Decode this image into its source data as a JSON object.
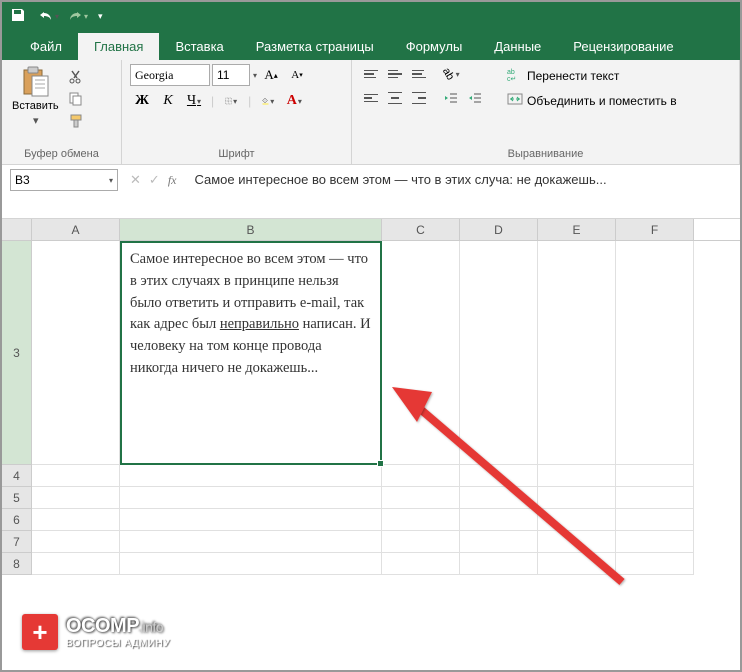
{
  "tabs": {
    "file": "Файл",
    "home": "Главная",
    "insert": "Вставка",
    "layout": "Разметка страницы",
    "formulas": "Формулы",
    "data": "Данные",
    "review": "Рецензирование"
  },
  "ribbon": {
    "clipboard": {
      "label": "Буфер обмена",
      "paste": "Вставить"
    },
    "font": {
      "label": "Шрифт",
      "name": "Georgia",
      "size": "11",
      "bold": "Ж",
      "italic": "К",
      "underline": "Ч"
    },
    "alignment": {
      "label": "Выравнивание",
      "wrap": "Перенести текст",
      "merge": "Объединить и поместить в"
    }
  },
  "namebox": "B3",
  "formula_bar": "Самое интересное во всем этом — что в этих случаях в принципе нельзя было ответить и отправить e-mail, так как адрес был неправильно написан. И человеку на том конце провода никогда ничего не докажешь...",
  "formula_bar_visible": "Самое интересное во всем этом — что в этих случа: не докажешь...",
  "columns": [
    "A",
    "B",
    "C",
    "D",
    "E",
    "F"
  ],
  "rows": [
    "3",
    "4",
    "5",
    "6",
    "7",
    "8"
  ],
  "cell_b3": "Самое интересное во всем этом — что в этих случаях в принципе нельзя было ответить и отправить e-mail, так как адрес был <u>неправильно</u> написан. И человеку на том конце провода никогда ничего не докажешь...",
  "watermark": {
    "main": "OCOMP",
    "suffix": ".info",
    "sub": "ВОПРОСЫ АДМИНУ"
  }
}
